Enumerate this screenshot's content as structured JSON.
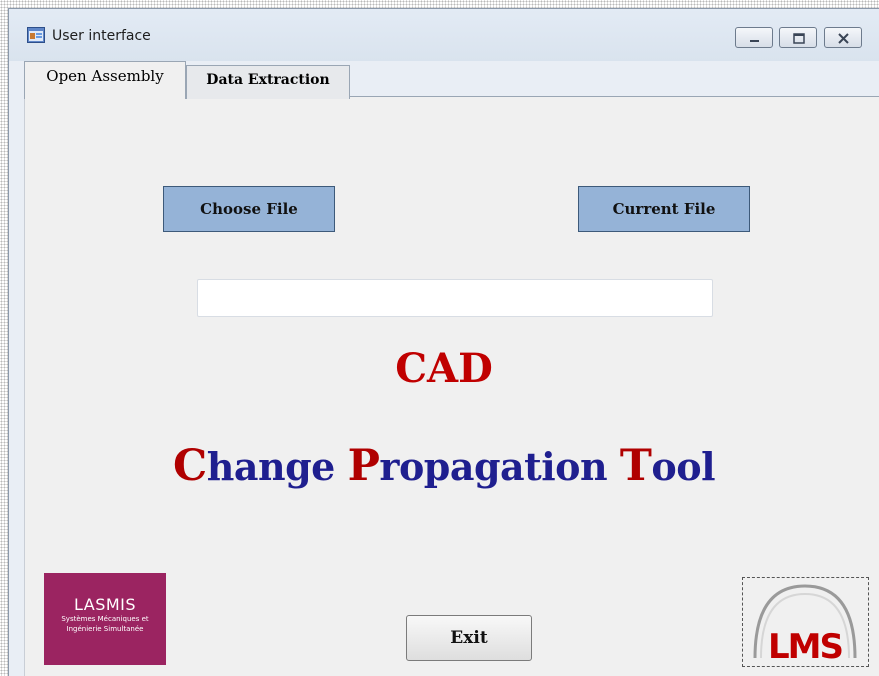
{
  "window": {
    "title": "User interface",
    "controls": [
      "minimize",
      "maximize",
      "close"
    ]
  },
  "tabs": [
    {
      "label": "Open Assembly",
      "active": true
    },
    {
      "label": "Data Extraction",
      "active": false
    }
  ],
  "open_assembly": {
    "choose_file_label": "Choose File",
    "current_file_label": "Current File",
    "file_path_value": "",
    "cad_title": "CAD",
    "tool_title": {
      "c_cap": "C",
      "c_rest": "hange ",
      "p_cap": "P",
      "p_rest": "ropagation ",
      "t_cap": "T",
      "t_rest": "ool"
    },
    "exit_label": "Exit"
  },
  "logos": {
    "lasmis": {
      "name": "LASMIS",
      "line1": "Systèmes Mécaniques et",
      "line2": "Ingénierie Simultanée"
    },
    "lms": {
      "text": "LMS"
    }
  },
  "colors": {
    "accent_blue": "#95b3d7",
    "title_red": "#c00000",
    "title_blue": "#1f1f8f",
    "lasmis_magenta": "#9b2461"
  }
}
